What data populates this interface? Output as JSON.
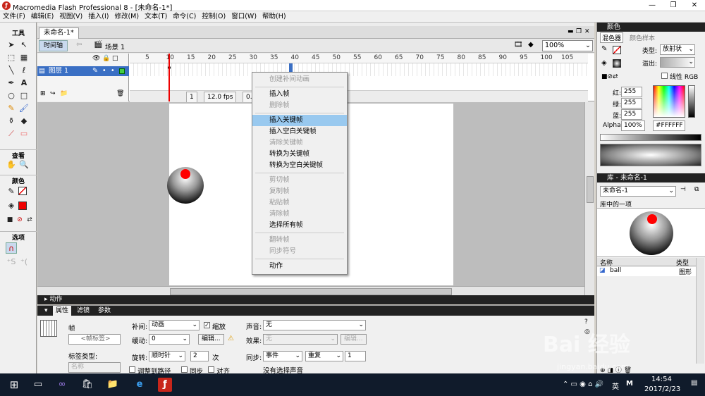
{
  "window": {
    "title": "Macromedia Flash Professional 8 - [未命名-1*]",
    "app_icon_letter": "ƒ"
  },
  "menu": [
    "文件(F)",
    "编辑(E)",
    "视图(V)",
    "插入(I)",
    "修改(M)",
    "文本(T)",
    "命令(C)",
    "控制(O)",
    "窗口(W)",
    "帮助(H)"
  ],
  "toolbox": {
    "title": "工具",
    "view_label": "查看",
    "color_label": "颜色",
    "options_label": "选项"
  },
  "document": {
    "tab": "未命名-1*",
    "timeline_button": "时间轴",
    "scene": "场景 1",
    "zoom": "100%"
  },
  "timeline": {
    "layer_name": "图层 1",
    "ruler_ticks": [
      "5",
      "10",
      "15",
      "20",
      "25",
      "30",
      "35",
      "40",
      "45",
      "50",
      "55",
      "60",
      "65",
      "70",
      "75",
      "80",
      "85",
      "90",
      "95",
      "100",
      "105"
    ],
    "current_frame": "1",
    "fps": "12.0 fps",
    "elapsed": "0.0s"
  },
  "context_menu": {
    "items": [
      {
        "label": "创建补间动画",
        "disabled": true
      },
      {
        "label": "插入帧",
        "disabled": false
      },
      {
        "label": "删除帧",
        "disabled": true
      },
      {
        "label": "插入关键帧",
        "disabled": false,
        "highlighted": true
      },
      {
        "label": "插入空白关键帧",
        "disabled": false
      },
      {
        "label": "清除关键帧",
        "disabled": true
      },
      {
        "label": "转换为关键帧",
        "disabled": false
      },
      {
        "label": "转换为空白关键帧",
        "disabled": false
      },
      {
        "label": "剪切帧",
        "disabled": true
      },
      {
        "label": "复制帧",
        "disabled": true
      },
      {
        "label": "粘贴帧",
        "disabled": true
      },
      {
        "label": "清除帧",
        "disabled": true
      },
      {
        "label": "选择所有帧",
        "disabled": false
      },
      {
        "label": "翻转帧",
        "disabled": true
      },
      {
        "label": "同步符号",
        "disabled": true
      },
      {
        "label": "动作",
        "disabled": false
      }
    ]
  },
  "actions_bar": "动作",
  "properties": {
    "tabs": [
      "属性",
      "滤镜",
      "参数"
    ],
    "frame_label": "帧",
    "frame_name_placeholder": "<帧标签>",
    "label_type": "标签类型:",
    "label_type_value": "名称",
    "tween_label": "补间:",
    "tween_value": "动画",
    "scale_label": "缩放",
    "ease_label": "缓动:",
    "ease_value": "0",
    "edit_button": "编辑...",
    "rotate_label": "旋转:",
    "rotate_value": "顺时针",
    "rotate_count": "2",
    "rotate_unit": "次",
    "orient_label": "调整到路径",
    "sync_label": "同步",
    "snap_label": "对齐",
    "sound_label": "声音:",
    "sound_value": "无",
    "effect_label": "效果:",
    "effect_value": "无",
    "effect_edit": "编辑...",
    "sync2_label": "同步:",
    "sync_value": "事件",
    "repeat_value": "重复",
    "repeat_count": "1",
    "no_sound": "没有选择声音"
  },
  "color_panel": {
    "header": "颜色",
    "tab_mixer": "混色器",
    "tab_swatches": "颜色样本",
    "type_label": "类型:",
    "type_value": "放射状",
    "overflow_label": "溢出:",
    "linear_rgb": "线性 RGB",
    "red_label": "红:",
    "red": "255",
    "green_label": "绿:",
    "green": "255",
    "blue_label": "蓝:",
    "blue": "255",
    "alpha_label": "Alpha:",
    "alpha": "100%",
    "hex": "#FFFFFF"
  },
  "library_panel": {
    "header": "库 - 未命名-1",
    "doc": "未命名-1",
    "preview_label": "库中的一项",
    "col_name": "名称",
    "col_type": "类型",
    "item_name": "ball",
    "item_type": "图形"
  },
  "taskbar": {
    "ime": "英",
    "ime2": "M",
    "time": "14:54",
    "date": "2017/2/23"
  },
  "watermark": "jingyan.baidu.com"
}
